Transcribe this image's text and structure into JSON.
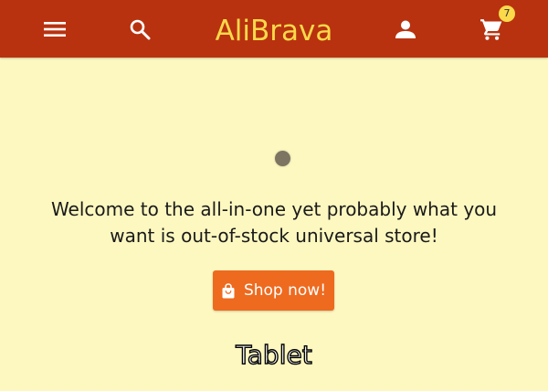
{
  "header": {
    "brand": "AliBrava",
    "cart_count": "7",
    "icons": [
      "menu-icon",
      "search-icon",
      "account-icon",
      "cart-icon"
    ]
  },
  "hero": {
    "welcome_text": "Welcome to the all-in-one yet probably what you want is out-of-stock universal store!",
    "shop_button_label": "Shop now!",
    "shop_button_icon": "shopping-bag-icon"
  },
  "caption": "Tablet",
  "colors": {
    "header_bg": "#b8320f",
    "brand_text": "#fbd94a",
    "page_bg": "#fdf8c0",
    "button_bg": "#ee6a1f"
  }
}
